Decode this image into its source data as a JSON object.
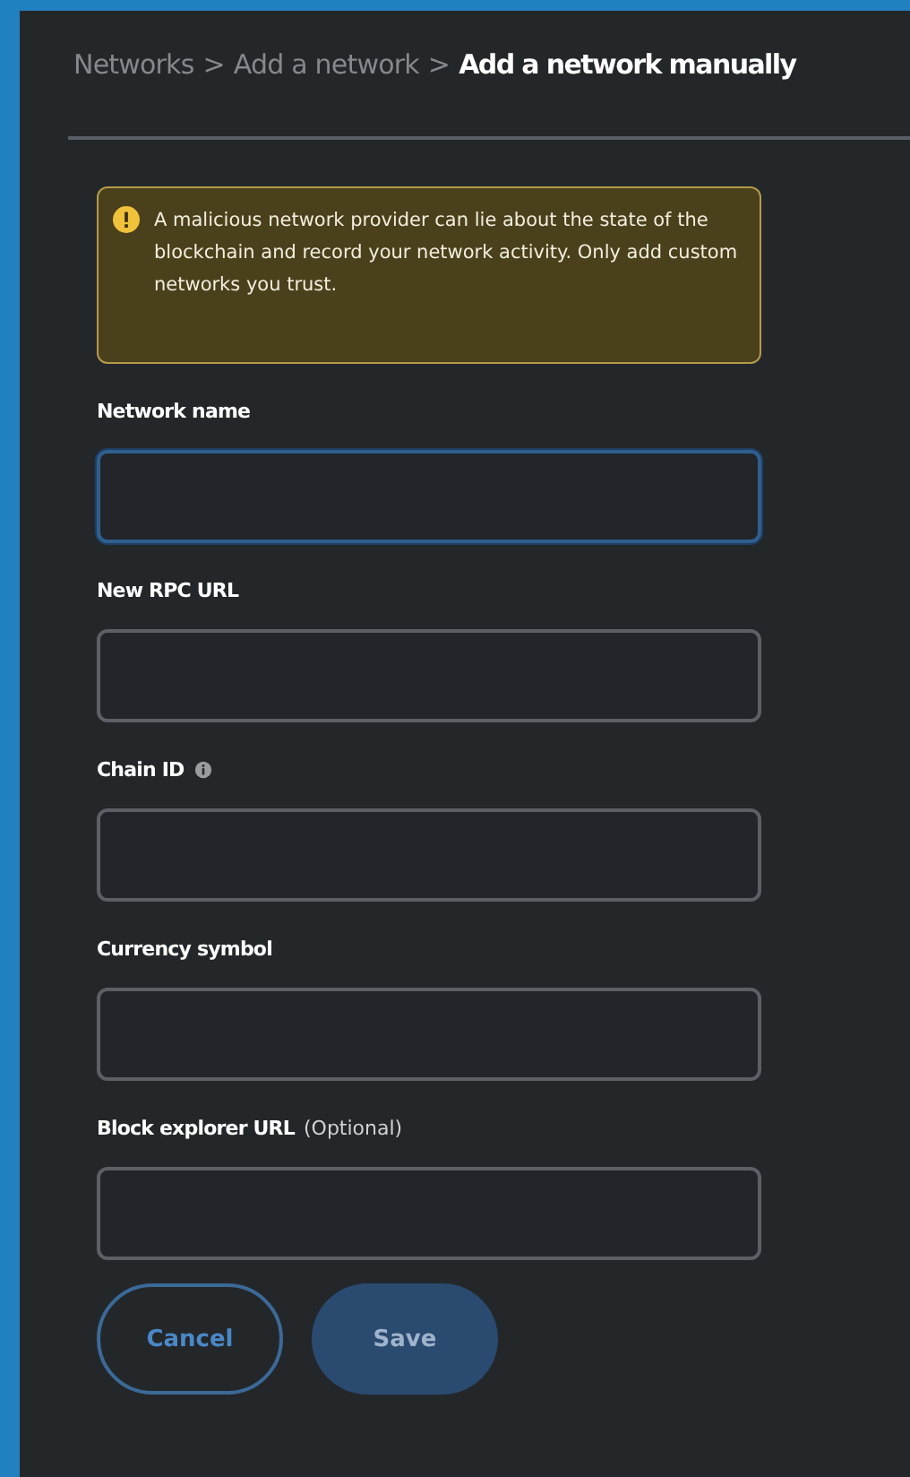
{
  "breadcrumb": [
    {
      "label": "Networks",
      "current": false
    },
    {
      "separator": ">",
      "label": "Add a network",
      "current": false
    },
    {
      "separator": ">",
      "label": "Add a network manually",
      "current": true
    }
  ],
  "warning": {
    "text": "A malicious network provider can lie about the state of the blockchain and record your network activity. Only add custom networks you trust."
  },
  "fields": [
    {
      "label": "Network name",
      "focused": true
    },
    {
      "label": "New RPC URL",
      "focused": false
    },
    {
      "label": "Chain ID",
      "info": true,
      "focused": false
    },
    {
      "label": "Currency symbol",
      "focused": false
    },
    {
      "label": "Block explorer URL",
      "suffix": "(Optional)",
      "focused": false
    }
  ],
  "buttons": [
    {
      "label": "Cancel",
      "kind": "secondary",
      "disabled": false
    },
    {
      "label": "Save",
      "kind": "primary",
      "disabled": true
    }
  ]
}
